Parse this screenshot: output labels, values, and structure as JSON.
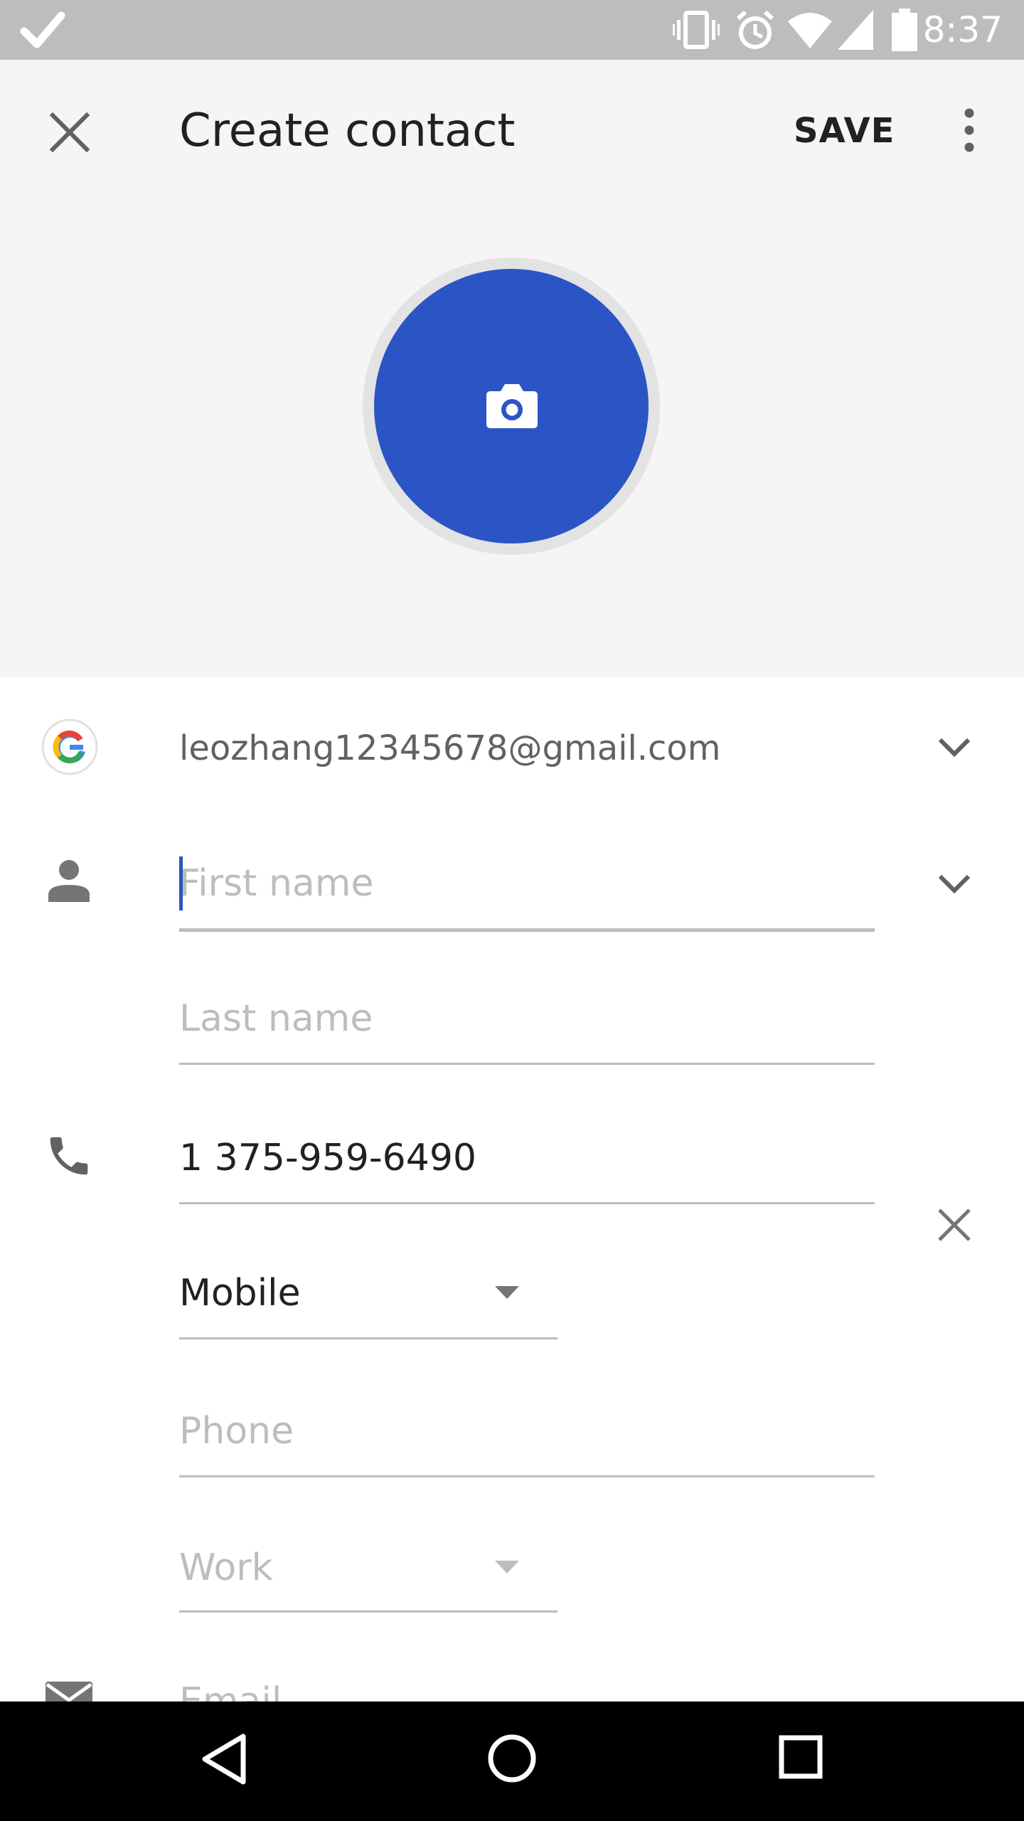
{
  "status_bar": {
    "time": "8:37"
  },
  "app_bar": {
    "title": "Create contact",
    "save_label": "SAVE"
  },
  "account": {
    "email": "leozhang12345678@gmail.com"
  },
  "name": {
    "first_name_placeholder": "First name",
    "last_name_placeholder": "Last name"
  },
  "phones": [
    {
      "value": "1 375-959-6490",
      "type": "Mobile"
    },
    {
      "placeholder": "Phone",
      "type": "Work"
    }
  ],
  "email_field": {
    "placeholder": "Email"
  },
  "colors": {
    "accent": "#2b55c4",
    "status_bar": "#bdbdbd",
    "header_bg": "#f5f5f5"
  }
}
